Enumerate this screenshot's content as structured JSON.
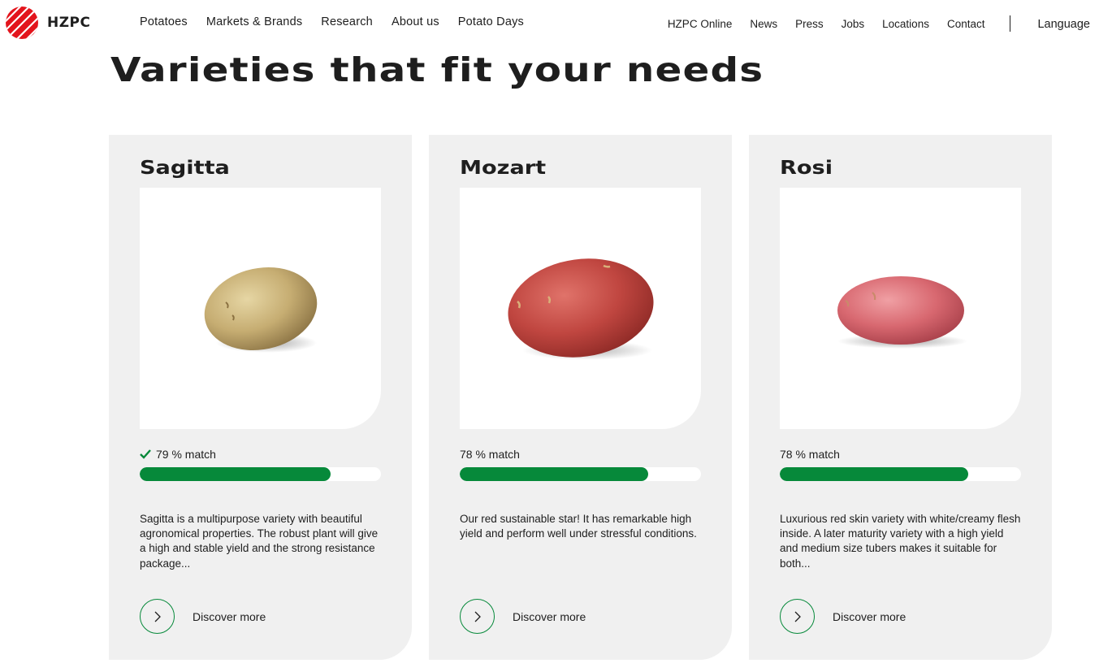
{
  "brand": {
    "name": "HZPC",
    "accent": "#06893a",
    "logo_color": "#e3141c"
  },
  "main_nav": [
    "Potatoes",
    "Markets & Brands",
    "Research",
    "About us",
    "Potato Days"
  ],
  "secondary_nav": [
    "HZPC Online",
    "News",
    "Press",
    "Jobs",
    "Locations",
    "Contact"
  ],
  "language_label": "Language",
  "page_title": "Varieties that fit your needs",
  "cards": [
    {
      "title": "Sagitta",
      "match_text": "79 % match",
      "match_percent": 79,
      "matched_check": true,
      "description": "Sagitta is a multipurpose variety with beautiful agronomical properties. The robust plant will give a high and stable yield and the strong resistance package...",
      "cta": "Discover more",
      "potato_color": "yellow-skin"
    },
    {
      "title": "Mozart",
      "match_text": "78 % match",
      "match_percent": 78,
      "matched_check": false,
      "description": "Our red sustainable star! It has remarkable high yield and perform well under stressful conditions.",
      "cta": "Discover more",
      "potato_color": "red-skin"
    },
    {
      "title": "Rosi",
      "match_text": "78 % match",
      "match_percent": 78,
      "matched_check": false,
      "description": "Luxurious red skin variety with white/creamy flesh inside. A later maturity variety with a high yield and medium size tubers makes it suitable for both...",
      "cta": "Discover more",
      "potato_color": "red-skin"
    }
  ]
}
